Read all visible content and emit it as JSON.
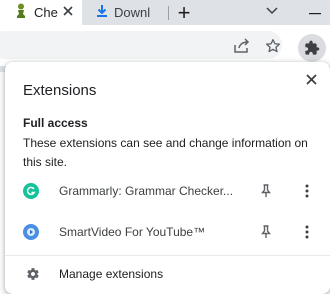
{
  "tabs": [
    {
      "title": "Che",
      "icon": "chess-pawn-icon",
      "active": true
    },
    {
      "title": "Downl",
      "icon": "download-icon",
      "active": false
    }
  ],
  "new_tab_symbol": "+",
  "popup": {
    "title": "Extensions",
    "section_heading": "Full access",
    "section_description": "These extensions can see and change information on this site.",
    "extensions": [
      {
        "name": "Grammarly: Grammar Checker...",
        "icon_color": "#15c39a"
      },
      {
        "name": "SmartVideo For YouTube™",
        "icon_color": "#4a90e2"
      }
    ],
    "manage_label": "Manage extensions"
  },
  "colors": {
    "tab_strip": "#dee1e6",
    "extension_button_bg": "#dadce0",
    "download_icon": "#1a73e8"
  }
}
